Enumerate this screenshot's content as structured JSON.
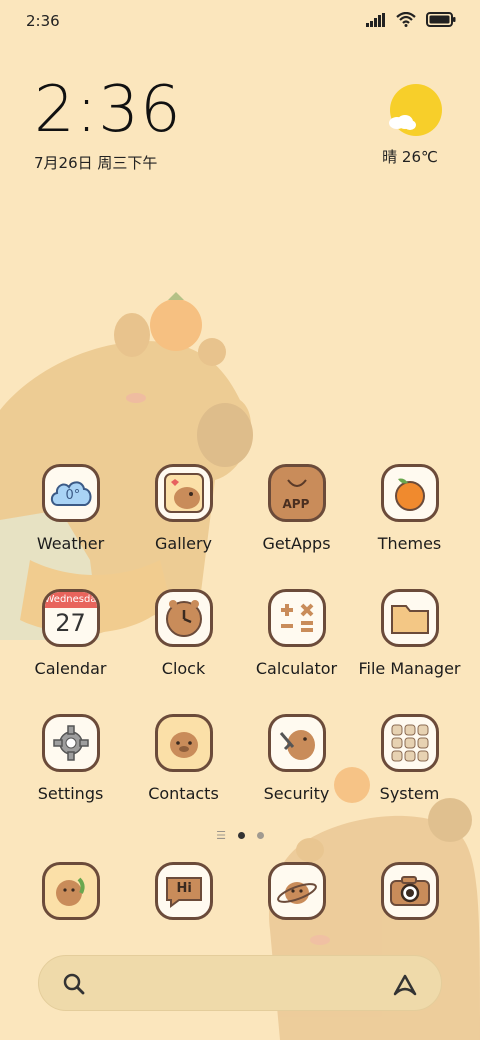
{
  "status": {
    "time": "2:36"
  },
  "clock": {
    "time": "2:36",
    "date": "7月26日 周三下午"
  },
  "weather": {
    "text": "晴 26℃"
  },
  "apps": [
    {
      "label": "Weather",
      "icon": "cloud-icon"
    },
    {
      "label": "Gallery",
      "icon": "capybara-photo-icon"
    },
    {
      "label": "GetApps",
      "icon": "app-bag-icon",
      "icon_text": "APP"
    },
    {
      "label": "Themes",
      "icon": "orange-icon"
    },
    {
      "label": "Calendar",
      "icon": "calendar-icon",
      "weekday": "Wednesday",
      "day": "27"
    },
    {
      "label": "Clock",
      "icon": "clock-icon"
    },
    {
      "label": "Calculator",
      "icon": "calculator-icon"
    },
    {
      "label": "File Manager",
      "icon": "folder-icon"
    },
    {
      "label": "Settings",
      "icon": "gear-icon"
    },
    {
      "label": "Contacts",
      "icon": "capybara-contact-icon"
    },
    {
      "label": "Security",
      "icon": "capybara-shield-icon"
    },
    {
      "label": "System",
      "icon": "system-folder-icon"
    }
  ],
  "weather_icon_text": "0°",
  "dock": [
    {
      "icon": "phone-capybara-icon"
    },
    {
      "icon": "message-hi-icon",
      "icon_text": "Hi"
    },
    {
      "icon": "browser-planet-icon"
    },
    {
      "icon": "camera-icon"
    }
  ],
  "colors": {
    "background": "#fbe6bd",
    "icon_border": "#6b4b3a",
    "sun": "#f7cf2a"
  }
}
